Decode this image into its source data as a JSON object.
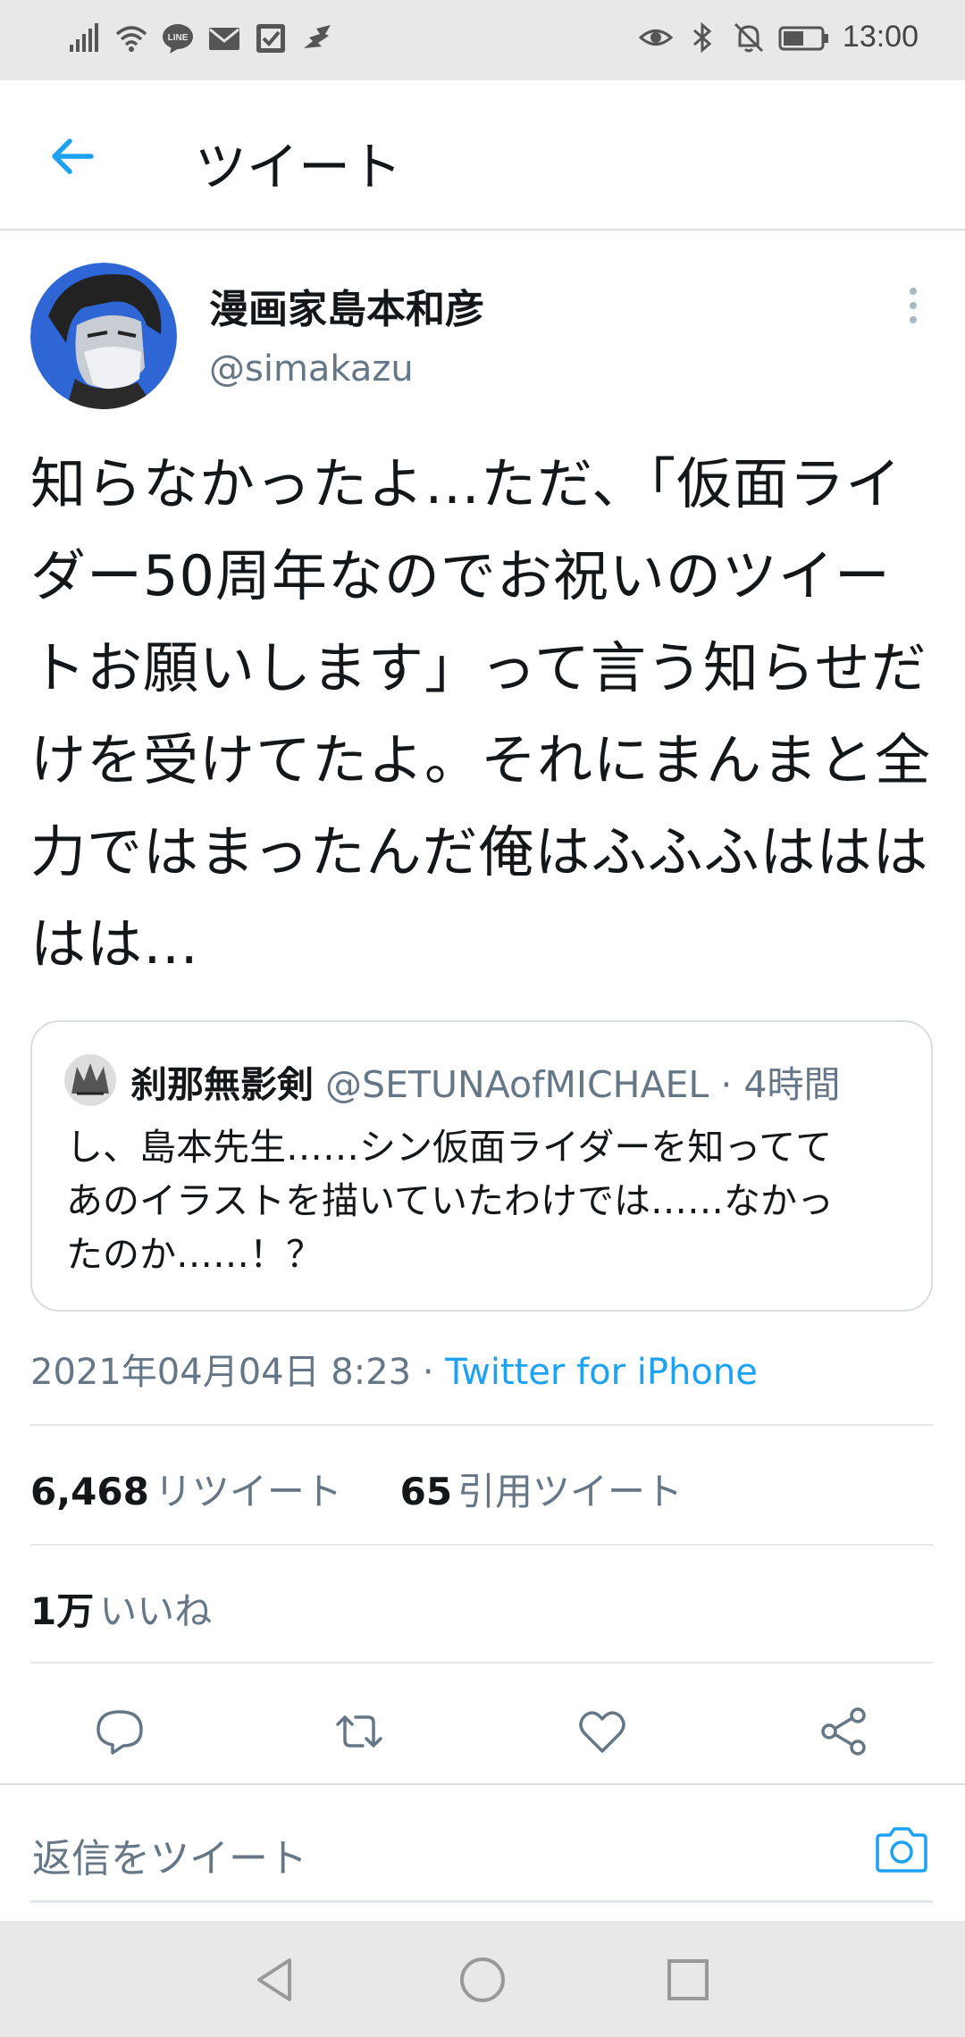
{
  "status_bar": {
    "time": "13:00",
    "left_icons": [
      "signal-icon",
      "wifi-icon",
      "line-app-icon",
      "mail-icon",
      "check-app-icon",
      "bird-app-icon"
    ],
    "right_icons": [
      "eye-icon",
      "bluetooth-icon",
      "mute-bell-icon",
      "battery-icon"
    ]
  },
  "app_bar": {
    "title": "ツイート"
  },
  "tweet": {
    "author_name": "漫画家島本和彦",
    "author_handle": "@simakazu",
    "text": "知らなかったよ…ただ、「仮面ライダー50周年なのでお祝いのツイートお願いします」って言う知らせだけを受けてたよ。それにまんまと全力ではまったんだ俺はふふふははははは…",
    "quote": {
      "author_name": "刹那無影剣",
      "author_handle": "@SETUNAofMICHAEL",
      "separator": "·",
      "time_ago": "4時間",
      "text": "し、島本先生……シン仮面ライダーを知ってて\nあのイラストを描いていたわけでは……なかっ\nたのか……！？"
    },
    "date": "2021年04月04日 8:23",
    "meta_separator": "·",
    "source": "Twitter for iPhone",
    "retweets_count": "6,468",
    "retweets_label": "リツイート",
    "quote_count": "65",
    "quote_label": "引用ツイート",
    "likes_count": "1万",
    "likes_label": "いいね"
  },
  "reply": {
    "placeholder": "返信をツイート"
  },
  "colors": {
    "accent": "#1da1f2",
    "secondary_text": "#657786",
    "primary_text": "#14171a",
    "divider": "#e1e8ed",
    "system_bar": "#e8e8e8"
  }
}
